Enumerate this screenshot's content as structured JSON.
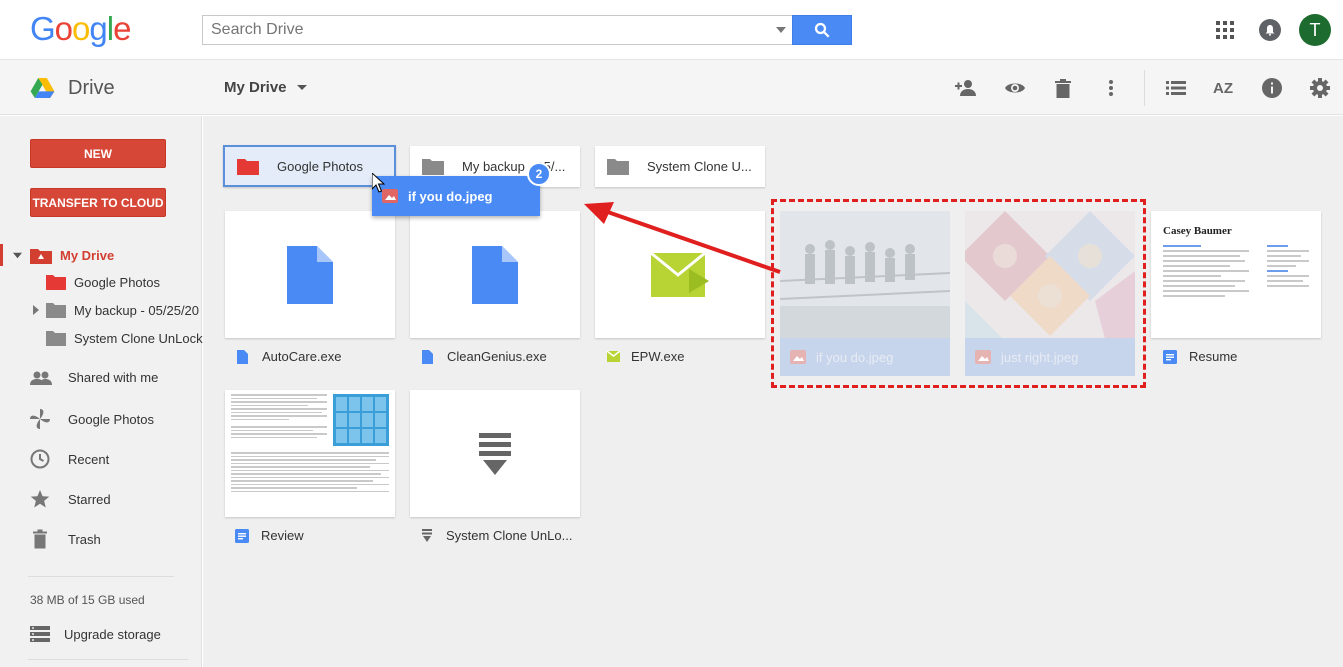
{
  "header": {
    "logo_letters": [
      "G",
      "o",
      "o",
      "g",
      "l",
      "e"
    ],
    "logo_colors": [
      "#4285f4",
      "#ea4335",
      "#fbbc05",
      "#4285f4",
      "#34a853",
      "#ea4335"
    ],
    "search_placeholder": "Search Drive",
    "avatar_initial": "T",
    "icons": [
      "search-icon",
      "apps-icon",
      "notifications-icon"
    ]
  },
  "toolbar": {
    "app_name": "Drive",
    "location_label": "My Drive",
    "icons": [
      "add-person-icon",
      "preview-eye-icon",
      "trash-icon",
      "more-vert-icon",
      "list-view-icon",
      "sort-az-icon",
      "info-icon",
      "settings-gear-icon"
    ],
    "sort_label": "AZ"
  },
  "sidebar": {
    "new_label": "NEW",
    "transfer_label": "TRANSFER TO CLOUD",
    "tree": {
      "root": "My Drive",
      "children": [
        "Google Photos",
        "My backup - 05/25/20",
        "System Clone UnLock"
      ]
    },
    "nav": [
      "Shared with me",
      "Google Photos",
      "Recent",
      "Starred",
      "Trash"
    ],
    "storage": "38 MB of 15 GB used",
    "upgrade": "Upgrade storage",
    "accent_color": "#d23f31"
  },
  "folders": [
    {
      "name": "Google Photos",
      "color": "#e53935",
      "selected": true
    },
    {
      "name": "My backup - 05/...",
      "color": "#8a8a8a",
      "selected": false
    },
    {
      "name": "System Clone U...",
      "color": "#8a8a8a",
      "selected": false
    }
  ],
  "drag": {
    "chip_label": "if you do.jpeg",
    "count": "2"
  },
  "files": [
    {
      "name": "AutoCare.exe",
      "type": "doc"
    },
    {
      "name": "CleanGenius.exe",
      "type": "doc"
    },
    {
      "name": "EPW.exe",
      "type": "envelope"
    },
    {
      "name": "if you do.jpeg",
      "type": "image"
    },
    {
      "name": "just right.jpeg",
      "type": "image"
    },
    {
      "name": "Resume",
      "type": "doc"
    },
    {
      "name": "Review",
      "type": "doc"
    },
    {
      "name": "System Clone UnLo...",
      "type": "archive"
    }
  ],
  "resume_preview": {
    "name": "Casey Baumer"
  },
  "colors": {
    "drive_blue": "#4a8af4",
    "drag_box_red": "#e0201f",
    "doc_blue": "#4a8af4",
    "epw_green": "#b7d334"
  }
}
